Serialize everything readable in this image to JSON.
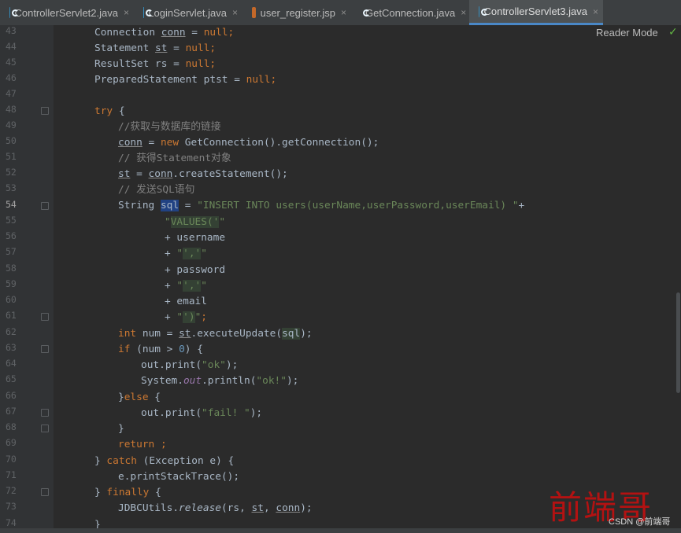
{
  "tabs": [
    {
      "label": "ControllerServlet2.java",
      "type": "java",
      "active": false
    },
    {
      "label": "LoginServlet.java",
      "type": "java",
      "active": false
    },
    {
      "label": "user_register.jsp",
      "type": "jsp",
      "active": false
    },
    {
      "label": "GetConnection.java",
      "type": "java",
      "active": false
    },
    {
      "label": "ControllerServlet3.java",
      "type": "java",
      "active": true
    }
  ],
  "close_glyph": "×",
  "reader_mode": "Reader Mode",
  "status_check": "✓",
  "line_numbers": [
    "43",
    "44",
    "45",
    "46",
    "47",
    "48",
    "49",
    "50",
    "51",
    "52",
    "53",
    "54",
    "55",
    "56",
    "57",
    "58",
    "59",
    "60",
    "61",
    "62",
    "63",
    "64",
    "65",
    "66",
    "67",
    "68",
    "69",
    "70",
    "71",
    "72",
    "73",
    "74"
  ],
  "watermark": {
    "text": "前端哥",
    "credit": "CSDN @前端哥"
  },
  "colors": {
    "keyword": "#cc7832",
    "string": "#6a8759",
    "comment": "#808080",
    "number": "#6897bb",
    "field": "#9876aa",
    "text": "#a9b7c6",
    "accent": "#4a88c7"
  },
  "code": {
    "l43": [
      "Connection ",
      "conn",
      " = ",
      "null",
      ";"
    ],
    "l44": [
      "Statement ",
      "st",
      " = ",
      "null",
      ";"
    ],
    "l45": [
      "ResultSet rs = ",
      "null",
      ";"
    ],
    "l46": [
      "PreparedStatement ptst = ",
      "null",
      ";"
    ],
    "l48": [
      "try",
      " {"
    ],
    "l49": [
      "//获取与数据库的链接"
    ],
    "l50": [
      "conn",
      " = ",
      "new",
      " GetConnection().getConnection();"
    ],
    "l51": [
      "// 获得Statement对象"
    ],
    "l52": [
      "st",
      " = ",
      "conn",
      ".createStatement();"
    ],
    "l53": [
      "// 发送SQL语句"
    ],
    "l54": [
      "String ",
      "sql",
      " = ",
      "\"INSERT INTO users(userName,userPassword,userEmail) \"",
      "+"
    ],
    "l55": [
      "\"",
      "VALUES('",
      "\""
    ],
    "l56": [
      "+ username"
    ],
    "l57": [
      "+ ",
      "\"",
      "','",
      "\""
    ],
    "l58": [
      "+ password"
    ],
    "l59": [
      "+ ",
      "\"",
      "','",
      "\""
    ],
    "l60": [
      "+ email"
    ],
    "l61": [
      "+ ",
      "\"",
      "')",
      "\"",
      ";"
    ],
    "l62": [
      "int",
      " num = ",
      "st",
      ".executeUpdate(",
      "sql",
      ");"
    ],
    "l63": [
      "if",
      " (num > ",
      "0",
      ") {"
    ],
    "l64": [
      "out.print(",
      "\"ok\"",
      ");"
    ],
    "l65": [
      "System.",
      "out",
      ".println(",
      "\"ok!\"",
      ");"
    ],
    "l66": [
      "}",
      "else",
      " {"
    ],
    "l67": [
      "out.print(",
      "\"fail! \"",
      ");"
    ],
    "l68": [
      "}"
    ],
    "l69": [
      "return",
      " ;"
    ],
    "l70": [
      "} ",
      "catch",
      " (Exception e) {"
    ],
    "l71": [
      "e.printStackTrace();"
    ],
    "l72": [
      "} ",
      "finally",
      " {"
    ],
    "l73": [
      "JDBCUtils.",
      "release",
      "(rs, ",
      "st",
      ", ",
      "conn",
      ");"
    ],
    "l74": [
      "}"
    ]
  }
}
